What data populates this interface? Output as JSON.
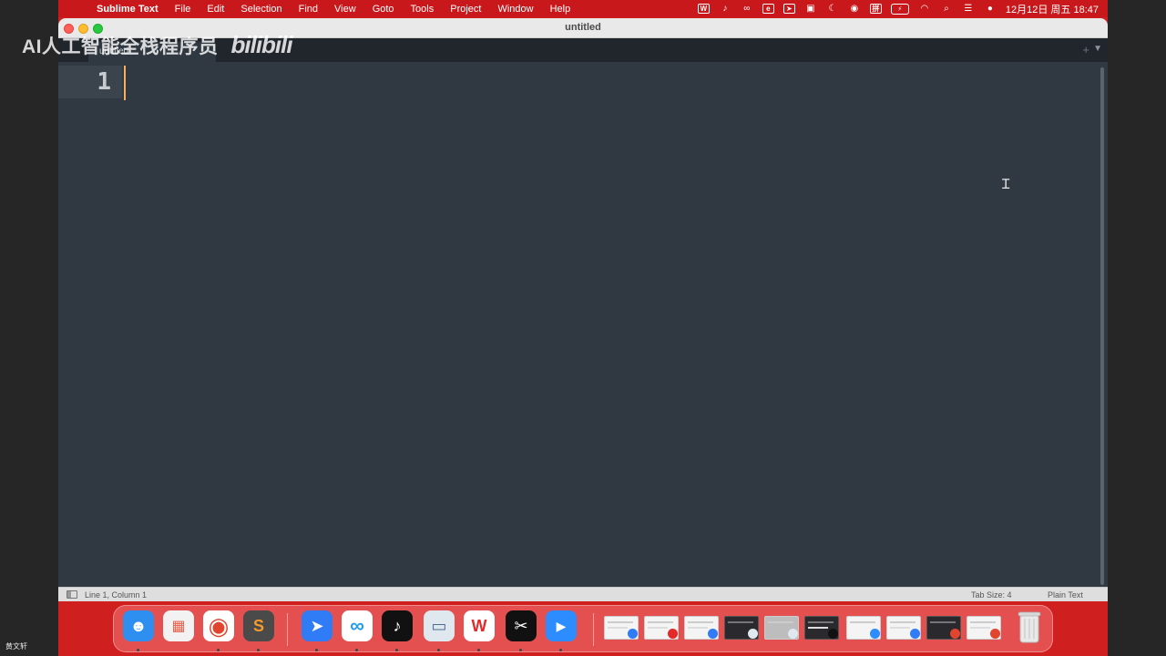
{
  "overlay": {
    "watermark_text": "AI人工智能全栈程序员",
    "watermark_logo": "bilibili",
    "corner_name": "黄文轩"
  },
  "menubar": {
    "app_name": "Sublime Text",
    "items": [
      "File",
      "Edit",
      "Selection",
      "Find",
      "View",
      "Goto",
      "Tools",
      "Project",
      "Window",
      "Help"
    ],
    "input_method": "拼",
    "clock": "12月12日 周五  18:47"
  },
  "window": {
    "title": "untitled",
    "tab_label": "untitled",
    "line_number": "1"
  },
  "statusbar": {
    "position": "Line 1, Column 1",
    "tab_size": "Tab Size: 4",
    "syntax": "Plain Text"
  },
  "dock": {
    "apps": [
      {
        "name": "Finder",
        "glyph": "☻",
        "color": "#2f8ff0"
      },
      {
        "name": "Launchpad",
        "glyph": "▦",
        "color": "#f2f2f2"
      },
      {
        "name": "Google Chrome",
        "glyph": "◉",
        "color": "#ffffff"
      },
      {
        "name": "Sublime Text",
        "glyph": "S",
        "color": "#4a4a4a"
      },
      {
        "name": "Lark",
        "glyph": "➤",
        "color": "#2f7cf6"
      },
      {
        "name": "Baidu Netdisk",
        "glyph": "∞",
        "color": "#ffffff"
      },
      {
        "name": "TikTok",
        "glyph": "♪",
        "color": "#111111"
      },
      {
        "name": "Preview",
        "glyph": "▭",
        "color": "#dfe7ef"
      },
      {
        "name": "WPS Office",
        "glyph": "W",
        "color": "#ffffff"
      },
      {
        "name": "CapCut",
        "glyph": "✂",
        "color": "#111111"
      },
      {
        "name": "Zoom",
        "glyph": "▶",
        "color": "#2d8cff"
      }
    ],
    "trash_label": "Trash"
  },
  "colors": {
    "menubar": "#c8181b",
    "editor_bg": "#303841",
    "caret": "#f9ae58"
  }
}
